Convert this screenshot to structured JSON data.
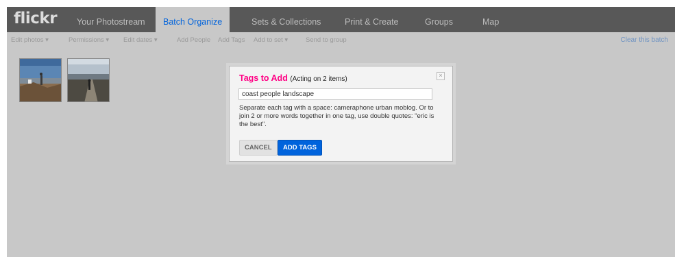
{
  "app": {
    "logo": "flickr"
  },
  "nav": {
    "photostream": "Your Photostream",
    "batch": "Batch Organize",
    "sets": "Sets & Collections",
    "print": "Print & Create",
    "groups": "Groups",
    "map": "Map"
  },
  "toolbar": {
    "edit_photos": "Edit photos ▾",
    "permissions": "Permissions ▾",
    "edit_dates": "Edit dates ▾",
    "add_people": "Add People",
    "add_tags": "Add Tags",
    "add_to_set": "Add to set ▾",
    "send_to_group": "Send to group",
    "clear_batch": "Clear this batch"
  },
  "dialog": {
    "title": "Tags to Add",
    "subtitle": "(Acting on 2 items)",
    "close_glyph": "×",
    "input_value": "coast people landscape",
    "help": "Separate each tag with a space: cameraphone urban moblog. Or to join 2 or more words together in one tag, use double quotes: \"eric is the best\".",
    "cancel": "CANCEL",
    "add": "ADD TAGS"
  },
  "colors": {
    "accent_blue": "#0063dc",
    "title_pink": "#ff0084"
  }
}
